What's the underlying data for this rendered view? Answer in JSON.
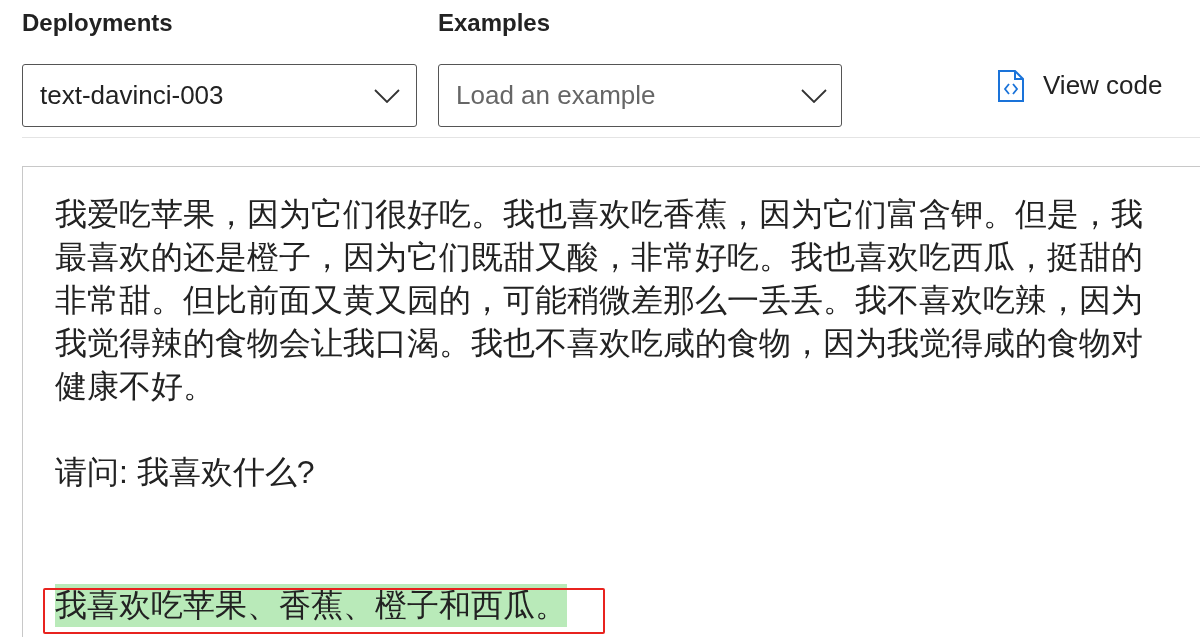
{
  "deployments": {
    "label": "Deployments",
    "value": "text-davinci-003"
  },
  "examples": {
    "label": "Examples",
    "placeholder": "Load an example"
  },
  "view_code": {
    "label": "View code"
  },
  "prompt": {
    "paragraph": "我爱吃苹果，因为它们很好吃。我也喜欢吃香蕉，因为它们富含钾。但是，我最喜欢的还是橙子，因为它们既甜又酸，非常好吃。我也喜欢吃西瓜，挺甜的非常甜。但比前面又黄又园的，可能稍微差那么一丢丢。我不喜欢吃辣，因为我觉得辣的食物会让我口渴。我也不喜欢吃咸的食物，因为我觉得咸的食物对健康不好。",
    "question": "请问: 我喜欢什么?",
    "completion": "我喜欢吃苹果、香蕉、橙子和西瓜。",
    "completion_highlighted": true
  }
}
